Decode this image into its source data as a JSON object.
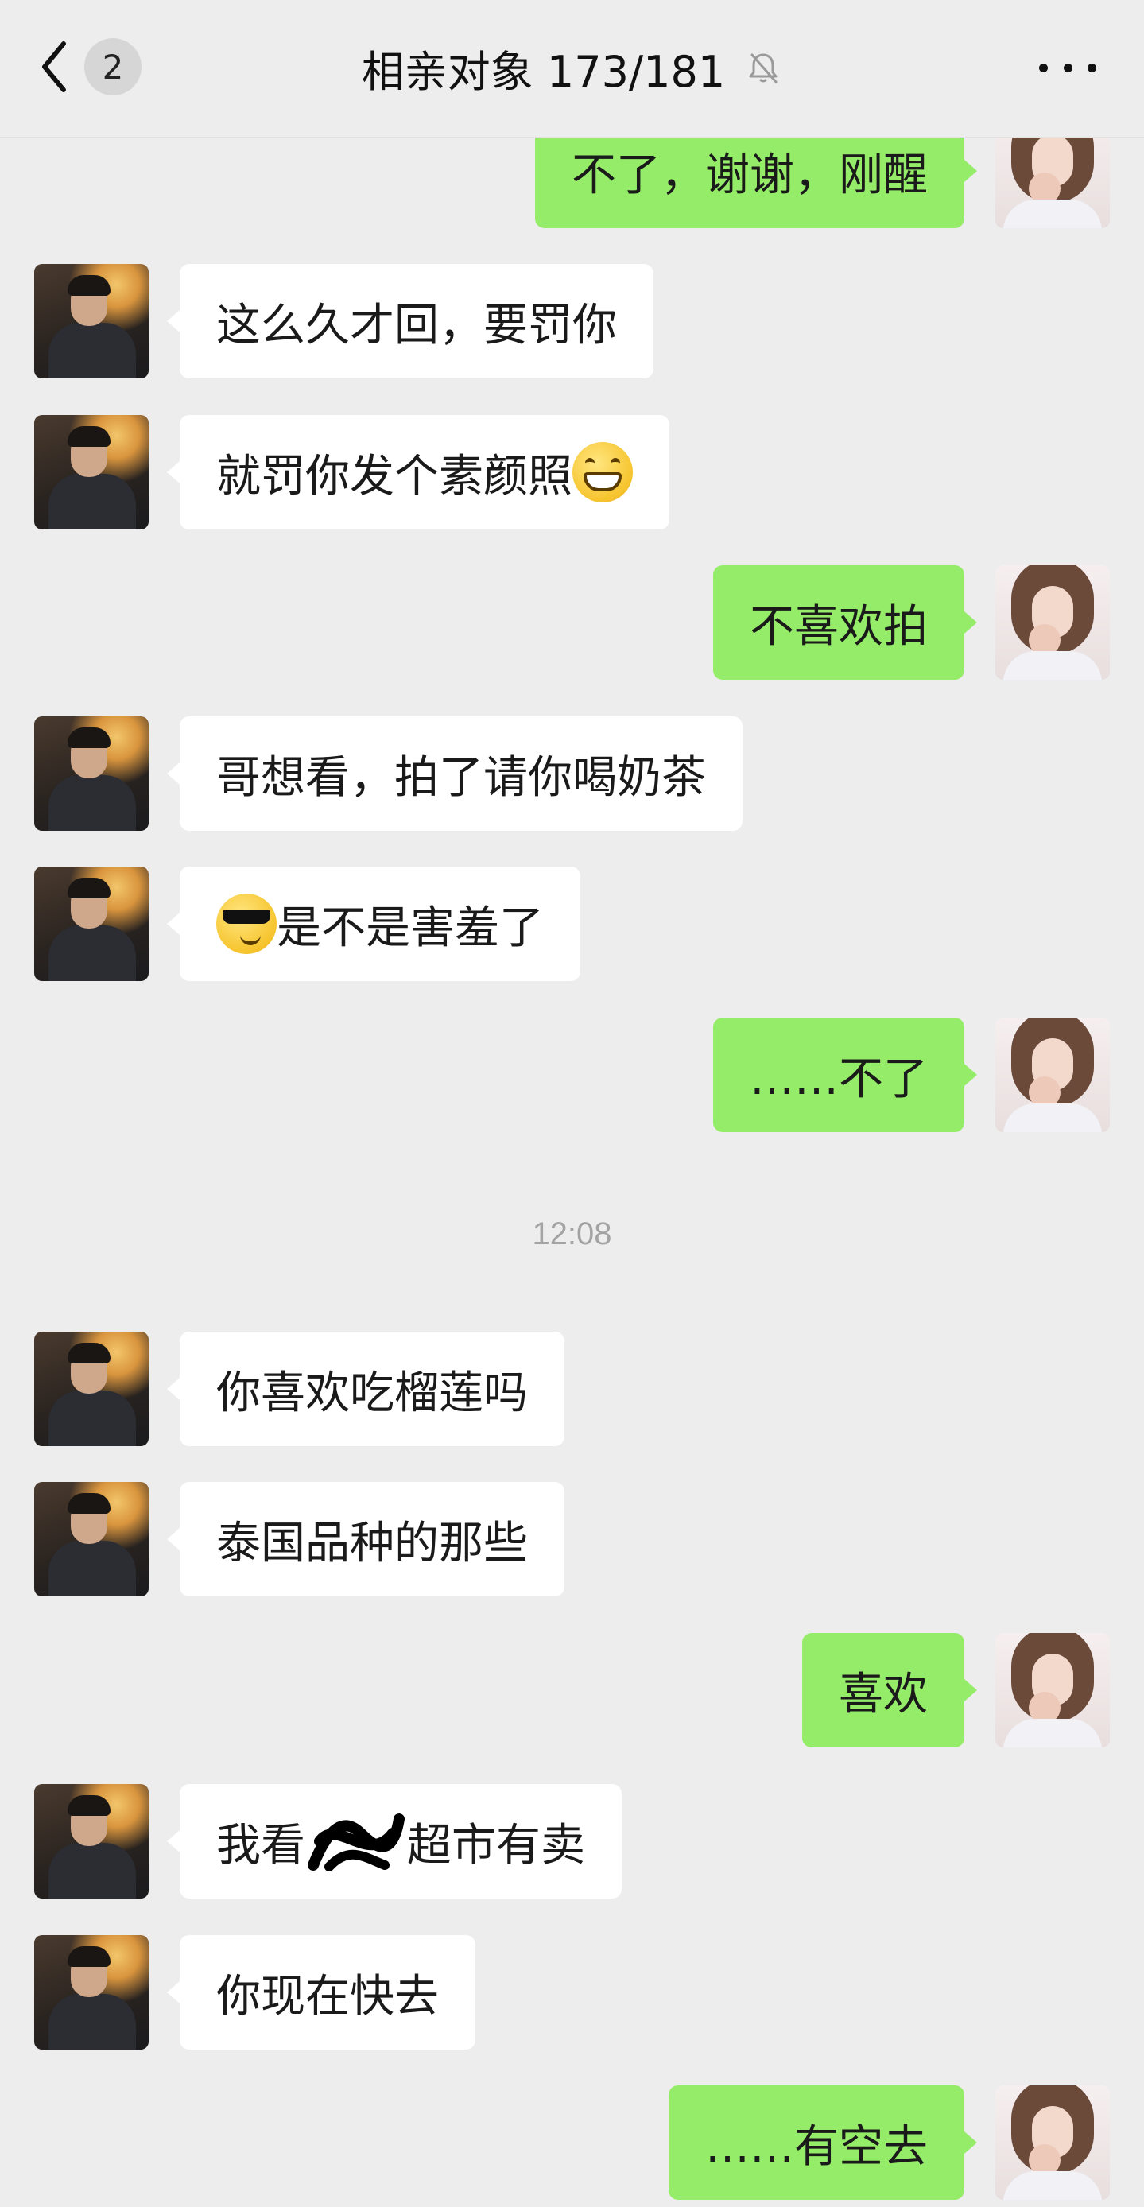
{
  "header": {
    "unread_count": "2",
    "title": "相亲对象  173/181"
  },
  "timestamp": "12:08",
  "messages": [
    {
      "side": "right",
      "text": "不了，谢谢，刚醒"
    },
    {
      "side": "left",
      "text": "这么久才回，要罚你"
    },
    {
      "side": "left",
      "text": "就罚你发个素颜照",
      "emoji": "grin-emoji"
    },
    {
      "side": "right",
      "text": "不喜欢拍"
    },
    {
      "side": "left",
      "text": "哥想看，拍了请你喝奶茶"
    },
    {
      "side": "left",
      "text": "是不是害羞了",
      "emoji": "cool-emoji"
    },
    {
      "side": "right",
      "text": "……不了"
    },
    {
      "side": "left",
      "text": "你喜欢吃榴莲吗"
    },
    {
      "side": "left",
      "text": "泰国品种的那些"
    },
    {
      "side": "right",
      "text": "喜欢"
    },
    {
      "side": "left",
      "text_before": "我看",
      "text_after": "超市有卖"
    },
    {
      "side": "left",
      "text": "你现在快去"
    },
    {
      "side": "right",
      "text": "……有空去"
    }
  ],
  "colors": {
    "background": "#ededed",
    "incoming_bubble": "#ffffff",
    "outgoing_bubble": "#95ec69"
  }
}
